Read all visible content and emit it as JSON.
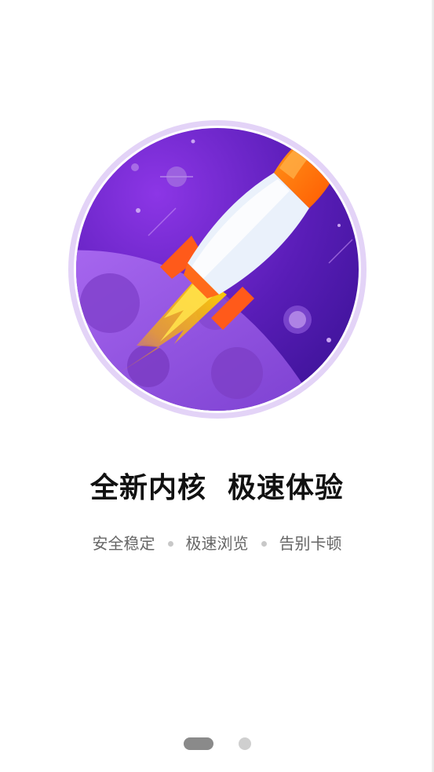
{
  "hero": {
    "illustration": "rocket-over-planet-illustration"
  },
  "headline": "全新内核  极速体验",
  "features": [
    {
      "label": "安全稳定"
    },
    {
      "label": "极速浏览"
    },
    {
      "label": "告别卡顿"
    }
  ],
  "pager": {
    "page_count": 2,
    "active_index": 0
  },
  "colors": {
    "planet_bg": "#6a22c4",
    "moon": "#9b5ae0",
    "rocket_nose": "#ff6a00",
    "rocket_body": "#eef3fb",
    "text_primary": "#111111",
    "text_secondary": "#666666"
  }
}
